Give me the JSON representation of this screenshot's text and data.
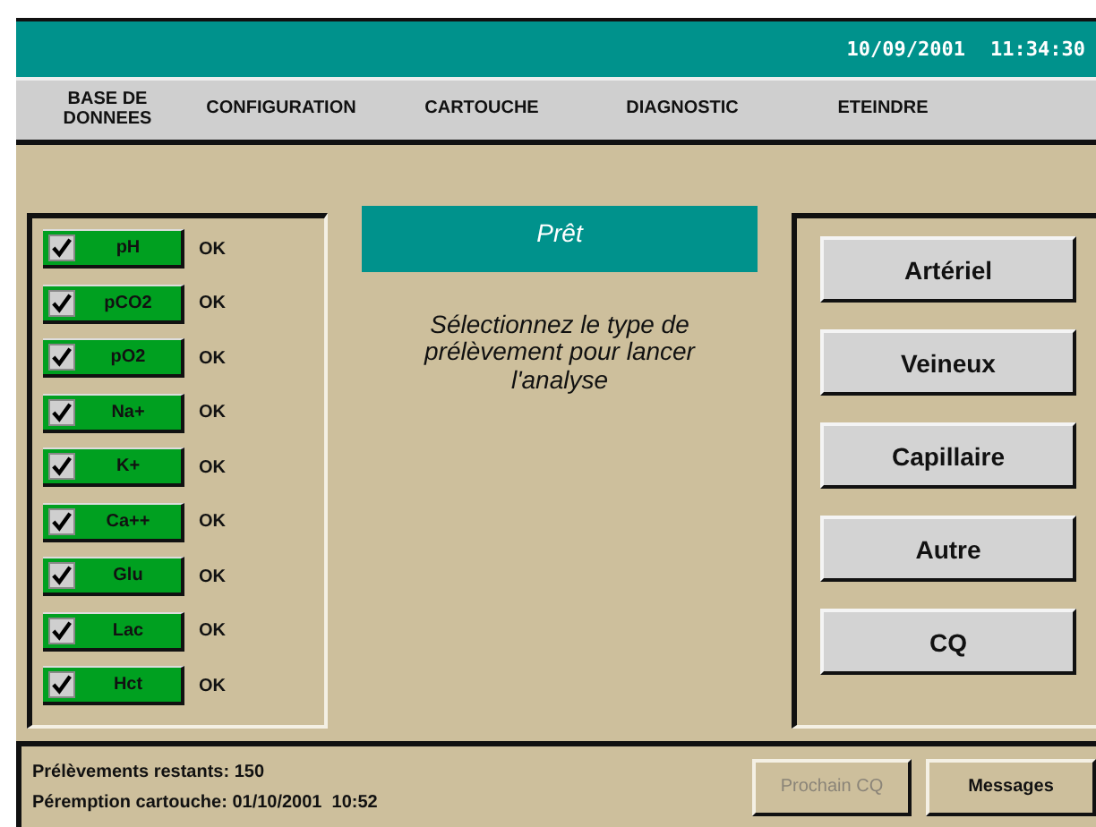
{
  "header": {
    "date": "10/09/2001",
    "time": "11:34:30"
  },
  "menu": [
    "BASE DE DONNEES",
    "CONFIGURATION",
    "CARTOUCHE",
    "DIAGNOSTIC",
    "ETEINDRE"
  ],
  "sensors": [
    {
      "label": "pH",
      "checked": true,
      "status": "OK"
    },
    {
      "label": "pCO2",
      "checked": true,
      "status": "OK"
    },
    {
      "label": "pO2",
      "checked": true,
      "status": "OK"
    },
    {
      "label": "Na+",
      "checked": true,
      "status": "OK"
    },
    {
      "label": "K+",
      "checked": true,
      "status": "OK"
    },
    {
      "label": "Ca++",
      "checked": true,
      "status": "OK"
    },
    {
      "label": "Glu",
      "checked": true,
      "status": "OK"
    },
    {
      "label": "Lac",
      "checked": true,
      "status": "OK"
    },
    {
      "label": "Hct",
      "checked": true,
      "status": "OK"
    }
  ],
  "status_title": "Prêt",
  "instruction": "Sélectionnez le type de prélèvement pour lancer l'analyse",
  "sample_buttons": [
    "Artériel",
    "Veineux",
    "Capillaire",
    "Autre",
    "CQ"
  ],
  "status_bar": {
    "lines": [
      "Prélèvements restants: 150",
      "Péremption cartouche: 01/10/2001  10:52"
    ],
    "buttons": [
      {
        "label": "Prochain CQ",
        "disabled": true
      },
      {
        "label": "Messages",
        "disabled": false
      }
    ]
  }
}
